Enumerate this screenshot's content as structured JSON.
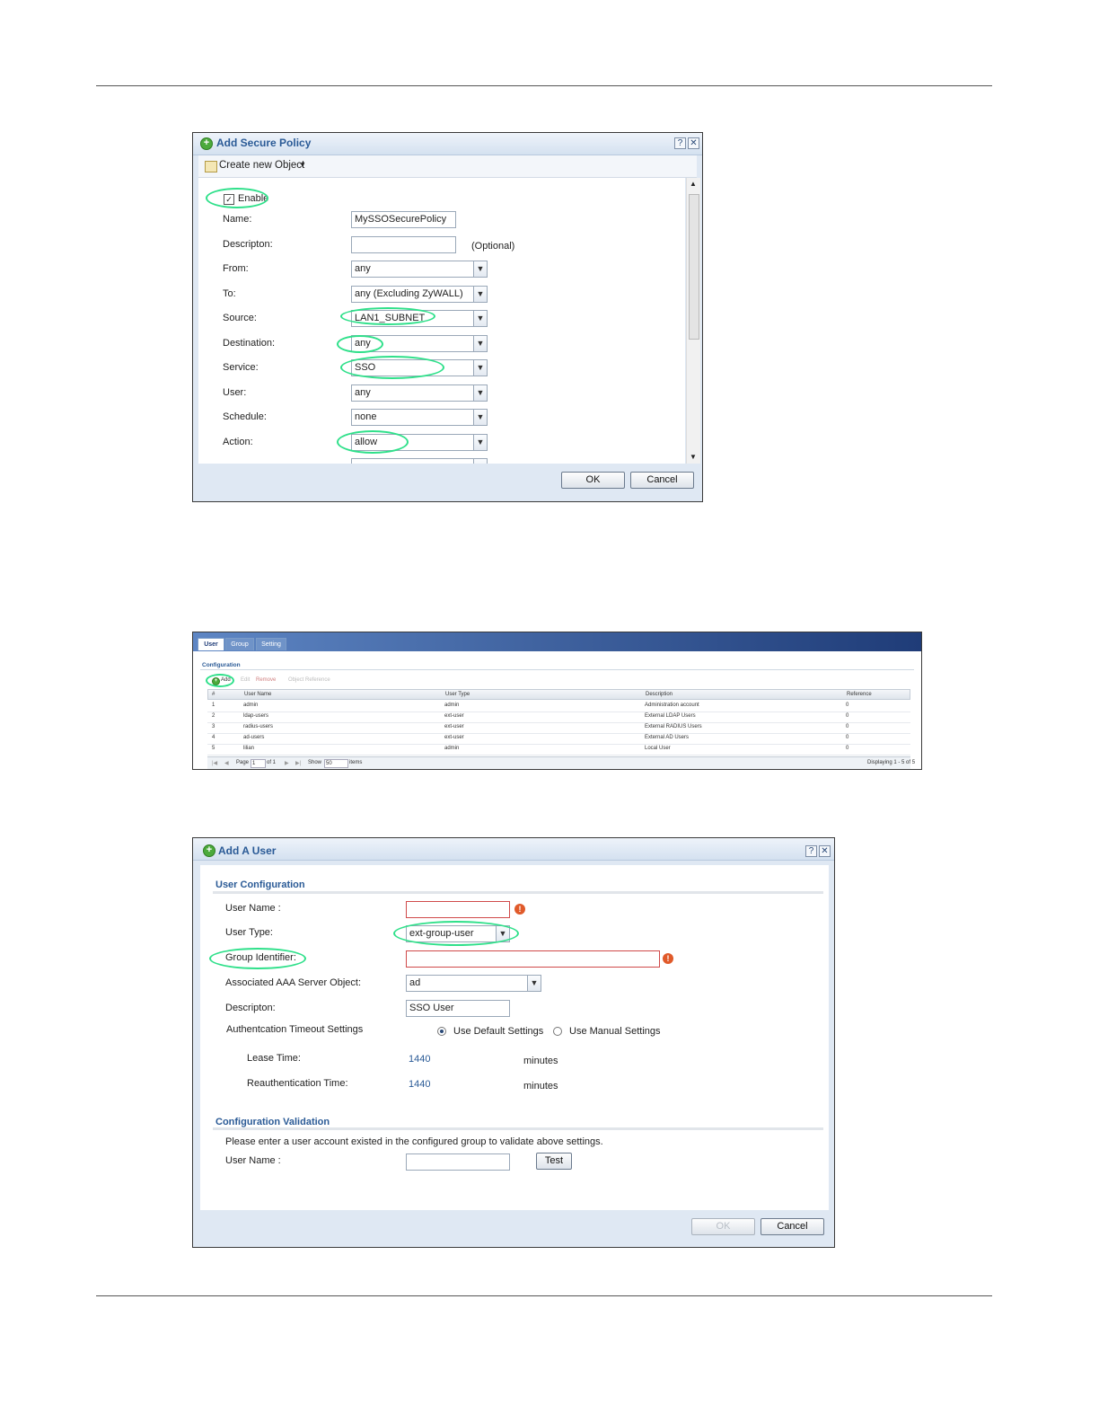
{
  "policy_dialog": {
    "title": "Add Secure Policy",
    "create_object": "Create new Object",
    "enable_label": "Enable",
    "enable_checked": true,
    "name_label": "Name:",
    "name_value": "MySSOSecurePolicy",
    "description_label": "Descripton:",
    "description_value": "",
    "optional_text": "(Optional)",
    "from_label": "From:",
    "from_value": "any",
    "to_label": "To:",
    "to_value": "any (Excluding ZyWALL)",
    "source_label": "Source:",
    "source_value": "LAN1_SUBNET",
    "destination_label": "Destination:",
    "destination_value": "any",
    "service_label": "Service:",
    "service_value": "SSO",
    "user_label": "User:",
    "user_value": "any",
    "schedule_label": "Schedule:",
    "schedule_value": "none",
    "action_label": "Action:",
    "action_value": "allow",
    "ok_label": "OK",
    "cancel_label": "Cancel"
  },
  "user_list": {
    "tabs": [
      "User",
      "Group",
      "Setting"
    ],
    "section_title": "Configuration",
    "toolbar": {
      "add": "Add",
      "edit": "Edit",
      "remove": "Remove",
      "object_reference": "Object Reference"
    },
    "columns": [
      "#",
      "User Name",
      "User Type",
      "Description",
      "Reference"
    ],
    "rows": [
      {
        "num": "1",
        "name": "admin",
        "type": "admin",
        "description": "Administration account",
        "reference": "0"
      },
      {
        "num": "2",
        "name": "ldap-users",
        "type": "ext-user",
        "description": "External LDAP Users",
        "reference": "0"
      },
      {
        "num": "3",
        "name": "radius-users",
        "type": "ext-user",
        "description": "External RADIUS Users",
        "reference": "0"
      },
      {
        "num": "4",
        "name": "ad-users",
        "type": "ext-user",
        "description": "External AD Users",
        "reference": "0"
      },
      {
        "num": "5",
        "name": "lilian",
        "type": "admin",
        "description": "Local User",
        "reference": "0"
      }
    ],
    "pager": {
      "page_label": "Page",
      "page_value": "1",
      "of_text": "of 1",
      "show_label": "Show",
      "show_value": "50",
      "items_label": "items",
      "displaying": "Displaying 1 - 5 of 5"
    }
  },
  "user_dialog": {
    "title": "Add A User",
    "section_user_config": "User Configuration",
    "user_name_label": "User Name :",
    "user_name_value": "",
    "user_type_label": "User Type:",
    "user_type_value": "ext-group-user",
    "group_identifier_label": "Group Identifier:",
    "group_identifier_value": "",
    "aaa_label": "Associated AAA Server Object:",
    "aaa_value": "ad",
    "description_label": "Descripton:",
    "description_value": "SSO User",
    "auth_timeout_label": "Authentcation Timeout Settings",
    "use_default": "Use Default Settings",
    "use_manual": "Use Manual Settings",
    "lease_label": "Lease Time:",
    "lease_value": "1440",
    "reauth_label": "Reauthentication Time:",
    "reauth_value": "1440",
    "minutes": "minutes",
    "section_validation": "Configuration Validation",
    "validation_text": "Please enter a user account existed in the configured group to validate above settings.",
    "val_user_name_label": "User Name :",
    "val_user_name_value": "",
    "test_label": "Test",
    "ok_label": "OK",
    "cancel_label": "Cancel"
  }
}
